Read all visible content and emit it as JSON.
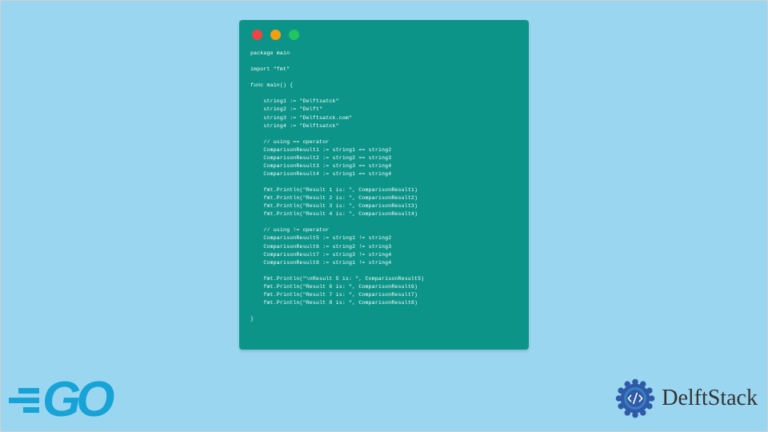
{
  "code": {
    "lines": [
      "package main",
      "",
      "import \"fmt\"",
      "",
      "func main() {",
      "",
      "    string1 := \"Delftsatck\"",
      "    string2 := \"Delft\"",
      "    string3 := \"Delftsatck.com\"",
      "    string4 := \"Delftsatck\"",
      "",
      "    // using == operator",
      "    ComparisonResult1 := string1 == string2",
      "    ComparisonResult2 := string2 == string3",
      "    ComparisonResult3 := string3 == string4",
      "    ComparisonResult4 := string1 == string4",
      "",
      "    fmt.Println(\"Result 1 is: \", ComparisonResult1)",
      "    fmt.Println(\"Result 2 is: \", ComparisonResult2)",
      "    fmt.Println(\"Result 3 is: \", ComparisonResult3)",
      "    fmt.Println(\"Result 4 is: \", ComparisonResult4)",
      "",
      "    // using != operator",
      "    ComparisonResult5 := string1 != string2",
      "    ComparisonResult6 := string2 != string3",
      "    ComparisonResult7 := string3 != string4",
      "    ComparisonResult8 := string1 != string4",
      "",
      "    fmt.Println(\"\\nResult 5 is: \", ComparisonResult5)",
      "    fmt.Println(\"Result 6 is: \", ComparisonResult6)",
      "    fmt.Println(\"Result 7 is: \", ComparisonResult7)",
      "    fmt.Println(\"Result 8 is: \", ComparisonResult8)",
      "",
      "}"
    ]
  },
  "logos": {
    "go_text": "GO",
    "delft_text": "DelftStack"
  },
  "colors": {
    "background": "#9ad6f0",
    "window": "#0d9488",
    "code_text": "#ffffff",
    "go_brand": "#17a3d6",
    "delft_outer": "#2f5aa8",
    "delft_inner": "#3a7dbf",
    "delft_text": "#333333"
  }
}
